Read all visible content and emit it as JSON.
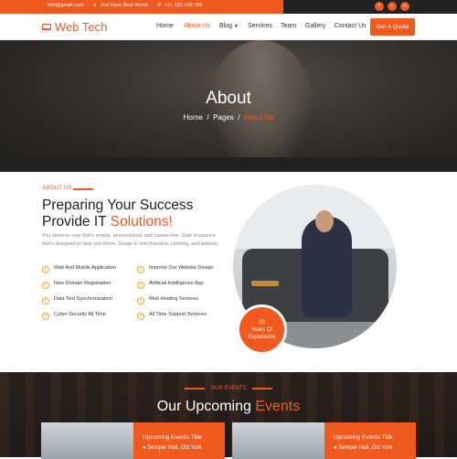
{
  "topbar": {
    "email": "info@gmail.com",
    "address": "2nd Floor Best World",
    "phone": "+91 123 456 789",
    "social": [
      "f",
      "t",
      "in"
    ]
  },
  "nav": {
    "brand": "Web Tech",
    "items": [
      "Home",
      "About Us",
      "Blog",
      "Services",
      "Team",
      "Gallery",
      "Contact Us"
    ],
    "active": "About Us",
    "quote_label": "Get A Quote"
  },
  "hero": {
    "title": "About",
    "breadcrumb": [
      "Home",
      "Pages",
      "About Us"
    ]
  },
  "about": {
    "eyebrow": "ABOUT US",
    "heading_line1": "Preparing Your Success",
    "heading_line2a": "Provide IT ",
    "heading_line2b": "Solutions!",
    "paragraph": "You deserve care that's simple, personalized, and hassle-free. Safe Insurance that's designed to help you thrive. Usage in merchandise, clothing, and artwork.",
    "features": [
      "Web And Mobile Application",
      "Improve Our Website Design",
      "New Domain Registration",
      "Artificial Intelligence App",
      "Data Text Synchronization",
      "Web Hosting Services",
      "Cyber Security All Time",
      "All Time Support Services"
    ],
    "badge_line1": "20",
    "badge_line2": "Years Of",
    "badge_line3": "Experience"
  },
  "events": {
    "eyebrow": "OUR EVENTS",
    "heading_a": "Our Upcoming ",
    "heading_b": "Events",
    "cards": [
      {
        "title": "Upcoming Events Title",
        "location": "Semper Hall, Old York"
      },
      {
        "title": "Upcoming Events Title",
        "location": "Semper Hall, Old York"
      }
    ]
  },
  "colors": {
    "accent": "#f05a1f",
    "dark": "#222222"
  }
}
